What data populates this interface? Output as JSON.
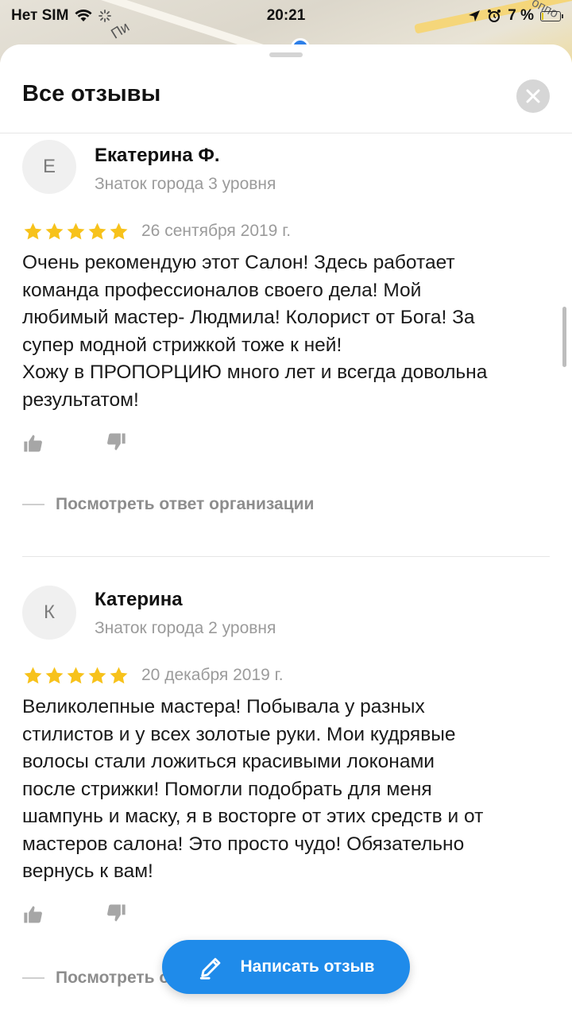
{
  "status_bar": {
    "carrier": "Нет SIM",
    "time": "20:21",
    "battery": "7 %",
    "battery_level": 0.07
  },
  "map": {
    "street_label": "Пи",
    "corner_label": "оппо"
  },
  "sheet": {
    "title": "Все отзывы"
  },
  "reviews": [
    {
      "initial": "Е",
      "author": "Екатерина Ф.",
      "level": "Знаток города 3 уровня",
      "rating": 5,
      "date": "26 сентября 2019 г.",
      "text": "Очень рекомендую этот Салон! Здесь работает\nкоманда профессионалов своего дела! Мой\nлюбимый мастер- Людмила! Колорист от Бога! За\nсупер модной стрижкой тоже к ней!\nХожу в ПРОПОРЦИЮ много лет и всегда довольна\nрезультатом!",
      "org_reply_label": "Посмотреть ответ организации"
    },
    {
      "initial": "К",
      "author": "Катерина",
      "level": "Знаток города 2 уровня",
      "rating": 5,
      "date": "20 декабря 2019 г.",
      "text": "Великолепные мастера! Побывала у разных\nстилистов и у всех золотые руки. Мои кудрявые\nволосы стали ложиться красивыми локонами\nпосле стрижки! Помогли подобрать для меня\nшампунь и маску, я в восторге от этих средств и от\nмастеров салона! Это просто чудо! Обязательно\nвернусь к вам!",
      "org_reply_label": "Посмотреть ответ организации"
    }
  ],
  "write_review_button": {
    "label": "Написать отзыв"
  },
  "colors": {
    "star": "#f7c21b",
    "accent": "#1f8bea",
    "muted": "#9b9b9b"
  },
  "icons": {
    "close": "close-icon",
    "like": "thumb-up-icon",
    "dislike": "thumb-down-icon",
    "pencil": "pencil-icon"
  }
}
